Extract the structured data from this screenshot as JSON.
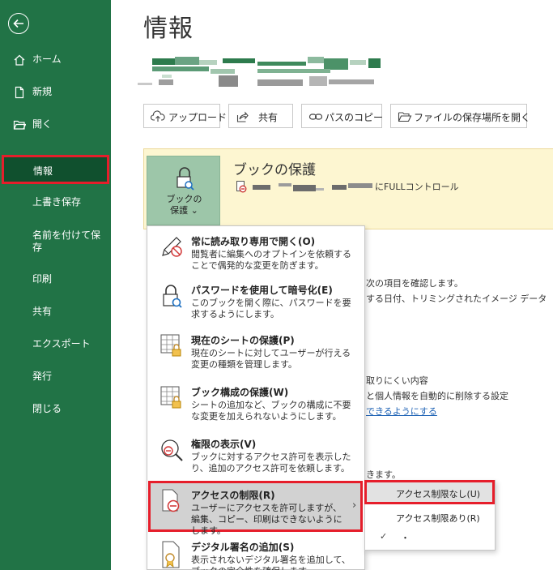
{
  "sidebar": {
    "items": [
      {
        "label": "ホーム",
        "icon": "home-icon"
      },
      {
        "label": "新規",
        "icon": "new-file-icon"
      },
      {
        "label": "開く",
        "icon": "folder-icon"
      },
      {
        "label": "情報"
      },
      {
        "label": "上書き保存"
      },
      {
        "label": "名前を付けて保存"
      },
      {
        "label": "印刷"
      },
      {
        "label": "共有"
      },
      {
        "label": "エクスポート"
      },
      {
        "label": "発行"
      },
      {
        "label": "閉じる"
      }
    ],
    "name_save_line1": "名前を付けて保",
    "name_save_line2": "存"
  },
  "main": {
    "title": "情報",
    "toolbar": [
      {
        "label": "アップロード",
        "icon": "upload-cloud-icon"
      },
      {
        "label": "共有",
        "icon": "share-icon"
      },
      {
        "label": "パスのコピー",
        "icon": "link-icon"
      },
      {
        "label": "ファイルの保存場所を開く",
        "icon": "folder-open-icon"
      }
    ],
    "protect": {
      "button_line1": "ブックの",
      "button_line2": "保護",
      "chevron": "⌄",
      "heading": "ブックの保護",
      "description_visible": "にFULLコントロール"
    },
    "background_text": {
      "line1": "次の項目を確認します。",
      "line2": "する日付、トリミングされたイメージ データ",
      "line3": "取りにくい内容",
      "line4": "と個人情報を自動的に削除する設定",
      "link": "できるようにする",
      "line5": "きます。"
    }
  },
  "menu": {
    "items": [
      {
        "title": "常に読み取り専用で開く(O)",
        "desc": "閲覧者に編集へのオプトインを依頼することで偶発的な変更を防ぎます。",
        "icon": "pencil-no-icon"
      },
      {
        "title": "パスワードを使用して暗号化(E)",
        "desc": "このブックを開く際に、パスワードを要求するようにします。",
        "icon": "lock-key-icon"
      },
      {
        "title": "現在のシートの保護(P)",
        "desc": "現在のシートに対してユーザーが行える変更の種類を管理します。",
        "icon": "sheet-lock-icon"
      },
      {
        "title": "ブック構成の保護(W)",
        "desc": "シートの追加など、ブックの構成に不要な変更を加えられないようにします。",
        "icon": "workbook-lock-icon"
      },
      {
        "title": "権限の表示(V)",
        "desc": "ブックに対するアクセス許可を表示したり、追加のアクセス許可を依頼します。",
        "icon": "magnifier-permission-icon"
      },
      {
        "title": "アクセスの制限(R)",
        "desc": "ユーザーにアクセスを許可しますが、編集、コピー、印刷はできないようにします。",
        "icon": "restrict-access-icon"
      },
      {
        "title": "デジタル署名の追加(S)",
        "desc": "表示されないデジタル署名を追加して、ブックの完全性を確保します。",
        "icon": "certificate-icon"
      }
    ],
    "chevron": "›"
  },
  "submenu": {
    "items": [
      {
        "label": "アクセス制限なし(U)"
      },
      {
        "label": "アクセス制限あり(R)"
      },
      {
        "label": "・"
      }
    ],
    "check": "✓"
  }
}
